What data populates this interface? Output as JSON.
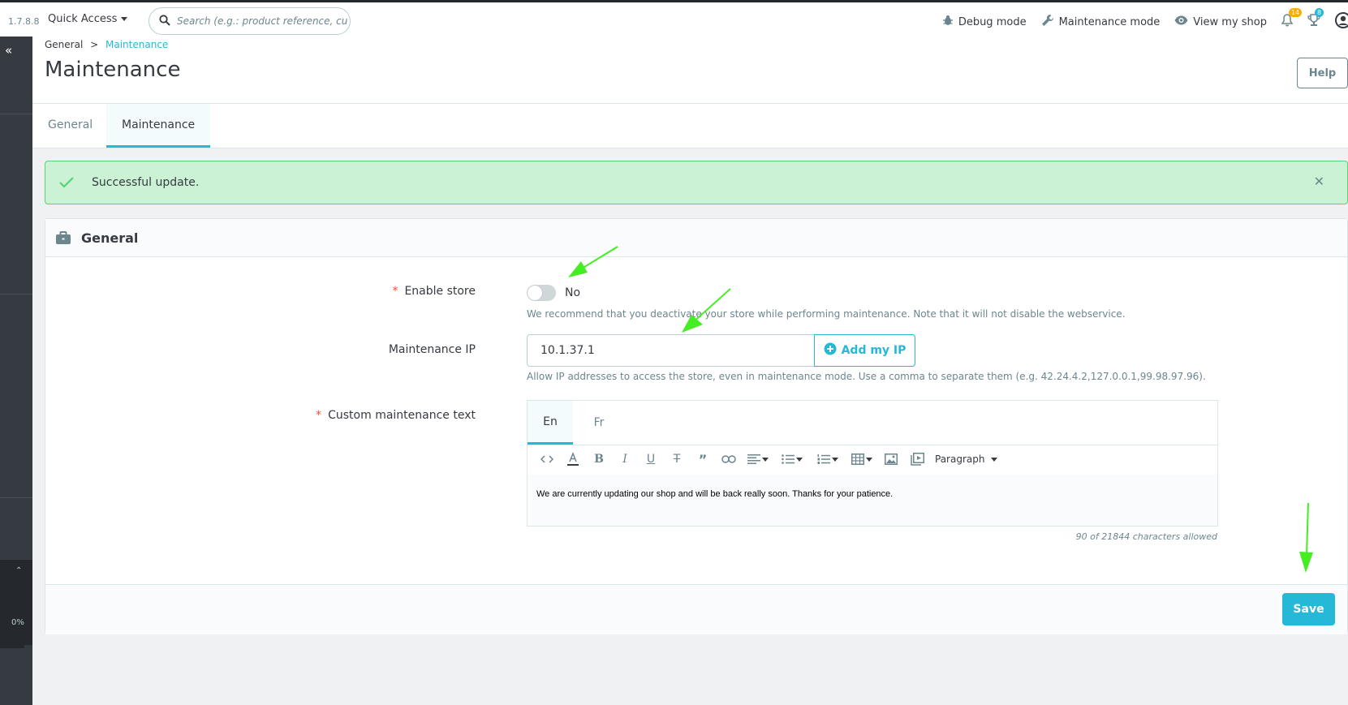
{
  "topbar": {
    "version": "1.7.8.8",
    "quick_access": "Quick Access",
    "search_placeholder": "Search (e.g.: product reference, custon",
    "debug_mode": "Debug mode",
    "maintenance_mode": "Maintenance mode",
    "view_shop": "View my shop",
    "notifications_count": "14",
    "orders_count": "8"
  },
  "sidebar": {
    "progress": "0%"
  },
  "breadcrumb": {
    "parent": "General",
    "separator": ">",
    "current": "Maintenance"
  },
  "page": {
    "title": "Maintenance",
    "help_label": "Help"
  },
  "tabs": [
    {
      "label": "General"
    },
    {
      "label": "Maintenance"
    }
  ],
  "alert": {
    "message": "Successful update."
  },
  "card": {
    "title": "General"
  },
  "form": {
    "enable_store": {
      "label": "Enable store",
      "value": "No",
      "help": "We recommend that you deactivate your store while performing maintenance. Note that it will not disable the webservice."
    },
    "maintenance_ip": {
      "label": "Maintenance IP",
      "value": "10.1.37.1",
      "button": "Add my IP",
      "help": "Allow IP addresses to access the store, even in maintenance mode. Use a comma to separate them (e.g. 42.24.4.2,127.0.0.1,99.98.97.96)."
    },
    "custom_text": {
      "label": "Custom maintenance text",
      "languages": [
        "En",
        "Fr"
      ],
      "format": "Paragraph",
      "content": "We are currently updating our shop and will be back really soon. Thanks for your patience.",
      "counter": "90 of 21844 characters allowed"
    }
  },
  "footer": {
    "save_label": "Save"
  },
  "colors": {
    "accent": "#25b9d7",
    "success_bg": "#cbf2d4",
    "sidebar": "#363a41",
    "annotation": "#44ee22"
  }
}
